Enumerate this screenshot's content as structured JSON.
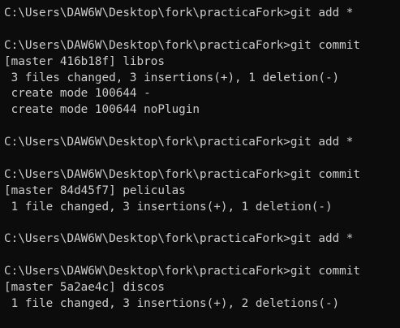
{
  "terminal": {
    "lines": [
      "C:\\Users\\DAW6W\\Desktop\\fork\\practicaFork>git add *",
      "",
      "C:\\Users\\DAW6W\\Desktop\\fork\\practicaFork>git commit",
      "[master 416b18f] libros",
      " 3 files changed, 3 insertions(+), 1 deletion(-)",
      " create mode 100644 -",
      " create mode 100644 noPlugin",
      "",
      "C:\\Users\\DAW6W\\Desktop\\fork\\practicaFork>git add *",
      "",
      "C:\\Users\\DAW6W\\Desktop\\fork\\practicaFork>git commit",
      "[master 84d45f7] peliculas",
      " 1 file changed, 3 insertions(+), 1 deletion(-)",
      "",
      "C:\\Users\\DAW6W\\Desktop\\fork\\practicaFork>git add *",
      "",
      "C:\\Users\\DAW6W\\Desktop\\fork\\practicaFork>git commit",
      "[master 5a2ae4c] discos",
      " 1 file changed, 3 insertions(+), 2 deletions(-)"
    ]
  }
}
